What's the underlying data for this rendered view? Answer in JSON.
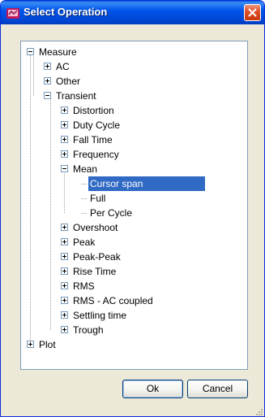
{
  "window": {
    "title": "Select Operation",
    "icon": "app-icon",
    "close_icon": "close-icon"
  },
  "tree": [
    {
      "label": "Measure",
      "state": "expanded"
    },
    {
      "label": "AC",
      "state": "collapsed"
    },
    {
      "label": "Other",
      "state": "collapsed"
    },
    {
      "label": "Transient",
      "state": "expanded"
    },
    {
      "label": "Distortion",
      "state": "collapsed"
    },
    {
      "label": "Duty Cycle",
      "state": "collapsed"
    },
    {
      "label": "Fall Time",
      "state": "collapsed"
    },
    {
      "label": "Frequency",
      "state": "collapsed"
    },
    {
      "label": "Mean",
      "state": "expanded"
    },
    {
      "label": "Cursor span",
      "state": "leaf",
      "selected": true
    },
    {
      "label": "Full",
      "state": "leaf"
    },
    {
      "label": "Per Cycle",
      "state": "leaf"
    },
    {
      "label": "Overshoot",
      "state": "collapsed"
    },
    {
      "label": "Peak",
      "state": "collapsed"
    },
    {
      "label": "Peak-Peak",
      "state": "collapsed"
    },
    {
      "label": "Rise Time",
      "state": "collapsed"
    },
    {
      "label": "RMS",
      "state": "collapsed"
    },
    {
      "label": "RMS - AC coupled",
      "state": "collapsed"
    },
    {
      "label": "Settling time",
      "state": "collapsed"
    },
    {
      "label": "Trough",
      "state": "collapsed"
    },
    {
      "label": "Plot",
      "state": "collapsed"
    }
  ],
  "buttons": {
    "ok_label": "Ok",
    "cancel_label": "Cancel"
  },
  "colors": {
    "titlebar": "#0055ea",
    "selection": "#316ac5",
    "dialog_bg": "#ece9d8"
  }
}
